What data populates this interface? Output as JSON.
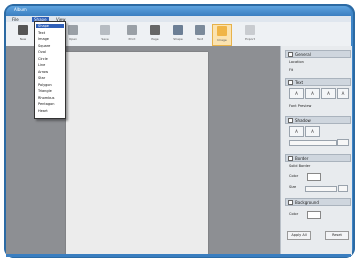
{
  "window": {
    "title": "Album"
  },
  "menu": [
    {
      "label": "File"
    },
    {
      "label": "Shape",
      "active": true
    },
    {
      "label": "View"
    }
  ],
  "toolbar": [
    {
      "icon": "new-icon",
      "label": "New",
      "color": "#555555"
    },
    {
      "icon": "open-icon",
      "label": "Open",
      "color": "#9aa0a6"
    },
    {
      "icon": "save-icon",
      "label": "Save",
      "color": "#b7bcc2"
    },
    {
      "icon": "print-icon",
      "label": "Print",
      "color": "#9aa0a6"
    },
    {
      "icon": "page-icon",
      "label": "Page",
      "color": "#666666"
    },
    {
      "icon": "shape-icon",
      "label": "Shape",
      "color": "#6c7f95"
    },
    {
      "icon": "text-icon",
      "label": "Text",
      "color": "#7b8a9a"
    },
    {
      "icon": "image-icon",
      "label": "Image",
      "color": "#f0b547",
      "active": true
    },
    {
      "icon": "export-icon",
      "label": "Export",
      "color": "#c9ccd0"
    }
  ],
  "dropdown": [
    "Shape",
    "Text",
    "Image",
    "Square",
    "Oval",
    "Circle",
    "Line",
    "Arrow",
    "Star",
    "Polygon",
    "Triangle",
    "Rhombus",
    "Pentagon",
    "Heart"
  ],
  "panel": {
    "general": {
      "title": "General",
      "label1": "Location",
      "label2": "Fit"
    },
    "text": {
      "title": "Text",
      "buttons": [
        "A",
        "A",
        "A",
        "A"
      ],
      "label": "Font Preview"
    },
    "shadow": {
      "title": "Shadow",
      "buttons": [
        "A",
        "A"
      ]
    },
    "border": {
      "title": "Border",
      "label": "Solid Border",
      "color_label": "Color",
      "size_label": "Size"
    },
    "background": {
      "title": "Background",
      "color_label": "Color"
    },
    "actions": {
      "apply": "Apply All",
      "reset": "Reset"
    }
  }
}
